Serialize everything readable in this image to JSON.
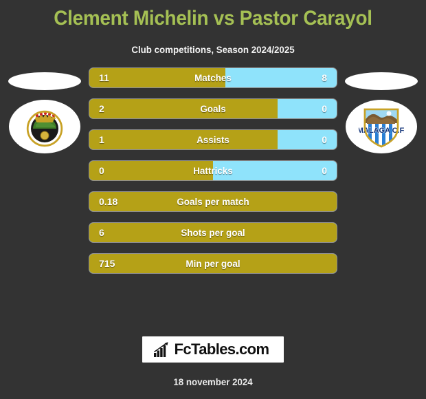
{
  "header": {
    "title": "Clement Michelin vs Pastor Carayol",
    "subtitle": "Club competitions, Season 2024/2025"
  },
  "colors": {
    "background": "#333333",
    "title": "#a5c054",
    "home_bar": "#b5a117",
    "away_bar": "#8fe3fb",
    "text": "#ffffff"
  },
  "players": {
    "home": {
      "name": "Clement Michelin",
      "club": "Real Racing Club Santander",
      "badge": "racing-santander-badge"
    },
    "away": {
      "name": "Pastor Carayol",
      "club": "Malaga C.F.",
      "badge": "malaga-cf-badge"
    }
  },
  "chart_data": {
    "type": "bar",
    "title": "Clement Michelin vs Pastor Carayol",
    "subtitle": "Club competitions, Season 2024/2025",
    "orientation": "horizontal-diverging",
    "series": [
      {
        "name": "Clement Michelin",
        "color": "#b5a117"
      },
      {
        "name": "Pastor Carayol",
        "color": "#8fe3fb"
      }
    ],
    "categories": [
      "Matches",
      "Goals",
      "Assists",
      "Hattricks",
      "Goals per match",
      "Shots per goal",
      "Min per goal"
    ],
    "rows": [
      {
        "label": "Matches",
        "left": "11",
        "right": "8",
        "left_pct": 55,
        "split": true
      },
      {
        "label": "Goals",
        "left": "2",
        "right": "0",
        "left_pct": 76,
        "split": true
      },
      {
        "label": "Assists",
        "left": "1",
        "right": "0",
        "left_pct": 76,
        "split": true
      },
      {
        "label": "Hattricks",
        "left": "0",
        "right": "0",
        "left_pct": 50,
        "split": true
      },
      {
        "label": "Goals per match",
        "left": "0.18",
        "right": "",
        "left_pct": 100,
        "split": false
      },
      {
        "label": "Shots per goal",
        "left": "6",
        "right": "",
        "left_pct": 100,
        "split": false
      },
      {
        "label": "Min per goal",
        "left": "715",
        "right": "",
        "left_pct": 100,
        "split": false
      }
    ]
  },
  "footer": {
    "logo_text": "FcTables.com",
    "logo_icon": "bar-chart-arrow-icon",
    "date": "18 november 2024"
  }
}
